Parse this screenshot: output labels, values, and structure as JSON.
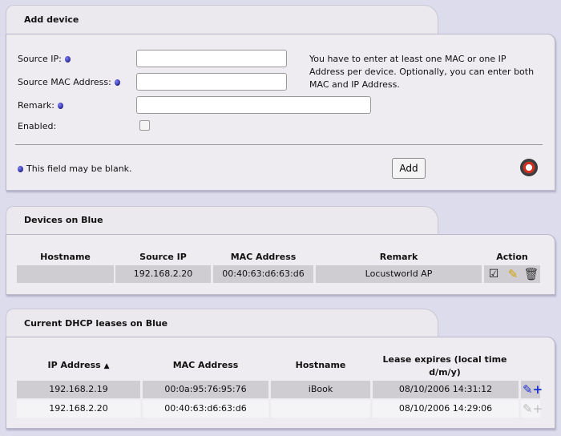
{
  "add_device": {
    "title": "Add device",
    "source_ip_label": "Source IP:",
    "source_mac_label": "Source MAC Address:",
    "remark_label": "Remark:",
    "enabled_label": "Enabled:",
    "source_ip_value": "",
    "source_mac_value": "",
    "remark_value": "",
    "help_text": "You have to enter at least one MAC or one IP Address per device. Optionally, you can enter both MAC and IP Address.",
    "blank_note": "This field may be blank.",
    "add_button": "Add"
  },
  "devices": {
    "title": "Devices on Blue",
    "headers": [
      "Hostname",
      "Source IP",
      "MAC Address",
      "Remark",
      "Action"
    ],
    "rows": [
      {
        "hostname": "",
        "ip": "192.168.2.20",
        "mac": "00:40:63:d6:63:d6",
        "remark": "Locustworld AP"
      }
    ]
  },
  "leases": {
    "title": "Current DHCP leases on Blue",
    "headers": [
      "IP Address",
      "MAC Address",
      "Hostname",
      "Lease expires (local time d/m/y)"
    ],
    "sort_indicator": "▲",
    "rows": [
      {
        "ip": "192.168.2.19",
        "mac": "00:0a:95:76:95:76",
        "hostname": "iBook",
        "expires": "08/10/2006 14:31:12"
      },
      {
        "ip": "192.168.2.20",
        "mac": "00:40:63:d6:63:d6",
        "hostname": "",
        "expires": "08/10/2006 14:29:06"
      }
    ]
  }
}
